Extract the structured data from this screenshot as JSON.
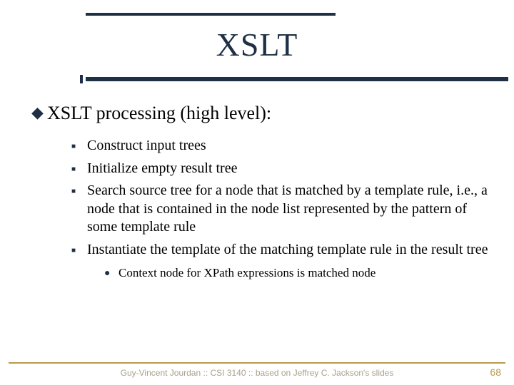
{
  "title": "XSLT",
  "heading": "XSLT processing (high level):",
  "items": [
    "Construct input trees",
    "Initialize empty result tree",
    "Search source tree for a node that is matched by a template rule, i.e., a node that is contained in the node list represented by the pattern of some template rule",
    "Instantiate the template of the matching template rule in the result tree"
  ],
  "subitem": "Context node for XPath expressions is matched node",
  "footer": "Guy-Vincent Jourdan :: CSI 3140 :: based on Jeffrey C. Jackson's slides",
  "page": "68"
}
